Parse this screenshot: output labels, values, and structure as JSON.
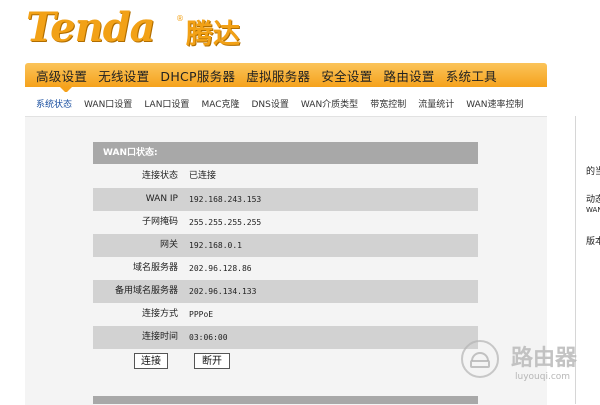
{
  "brand": {
    "name_en": "Tenda",
    "reg_mark": "®",
    "name_cn": "腾达"
  },
  "menu": [
    "高级设置",
    "无线设置",
    "DHCP服务器",
    "虚拟服务器",
    "安全设置",
    "路由设置",
    "系统工具"
  ],
  "submenu": [
    "系统状态",
    "WAN口设置",
    "LAN口设置",
    "MAC克隆",
    "DNS设置",
    "WAN介质类型",
    "带宽控制",
    "流量统计",
    "WAN速率控制"
  ],
  "active_submenu": "系统状态",
  "wan_status": {
    "title": "WAN口状态:",
    "rows": [
      {
        "label": "连接状态",
        "value": "已连接"
      },
      {
        "label": "WAN IP",
        "value": "192.168.243.153"
      },
      {
        "label": "子网掩码",
        "value": "255.255.255.255"
      },
      {
        "label": "网关",
        "value": "192.168.0.1"
      },
      {
        "label": "域名服务器",
        "value": "202.96.128.86"
      },
      {
        "label": "备用域名服务器",
        "value": "202.96.134.133"
      },
      {
        "label": "连接方式",
        "value": "PPPoE"
      },
      {
        "label": "连接时间",
        "value": "03:06:00"
      }
    ],
    "connect_label": "连接",
    "disconnect_label": "断开"
  },
  "right_panel": {
    "line1": "的当",
    "line2": "动态",
    "line3": "WAN",
    "line4": "版本"
  },
  "watermark": {
    "cn": "路由器",
    "en": "luyouqi.com"
  },
  "colors": {
    "menu_orange": "#f5a21c",
    "brand_orange": "#f2a116",
    "row_gray": "#d2d2d2"
  }
}
